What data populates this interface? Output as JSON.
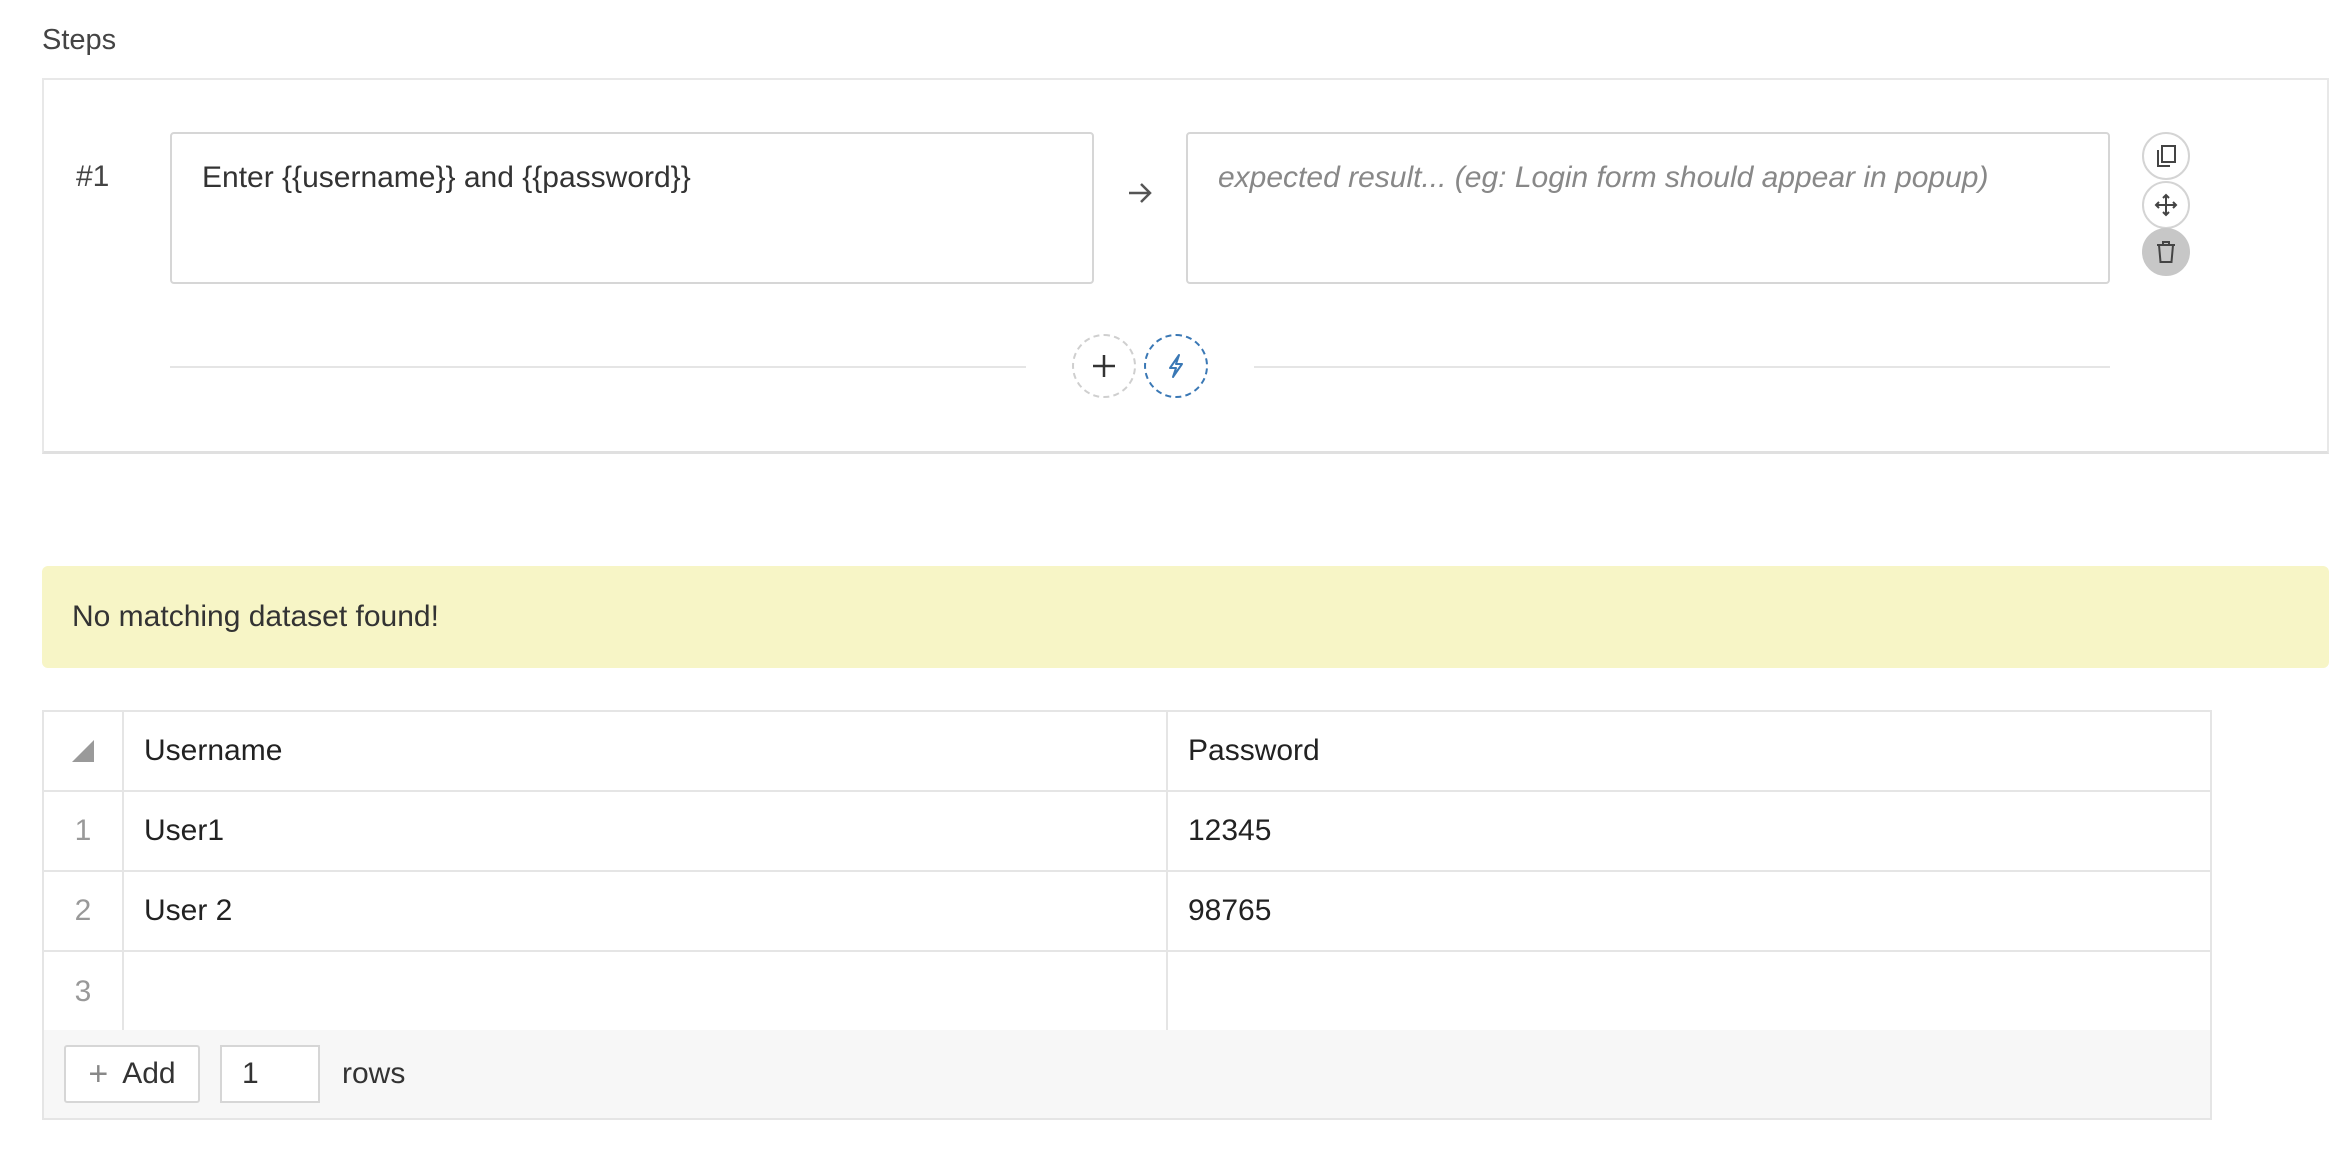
{
  "steps_section": {
    "label": "Steps",
    "step": {
      "number": "#1",
      "action_text": "Enter {{username}} and {{password}}",
      "expected_placeholder": "expected result... (eg: Login form should appear in popup)"
    },
    "tools": [
      "copy-icon",
      "move-icon",
      "trash-icon"
    ]
  },
  "alert": {
    "message": "No matching dataset found!"
  },
  "dataset_table": {
    "columns": [
      "Username",
      "Password"
    ],
    "rows": [
      {
        "index": "1",
        "username": "User1",
        "password": "12345"
      },
      {
        "index": "2",
        "username": "User 2",
        "password": "98765"
      },
      {
        "index": "3",
        "username": "",
        "password": ""
      }
    ]
  },
  "table_footer": {
    "add_label": "Add",
    "rows_count": "1",
    "rows_label": "rows"
  },
  "colors": {
    "alert_background": "#f7f5c6",
    "magic_accent": "#3a78b5",
    "delete_button": "#c7c7c7"
  }
}
